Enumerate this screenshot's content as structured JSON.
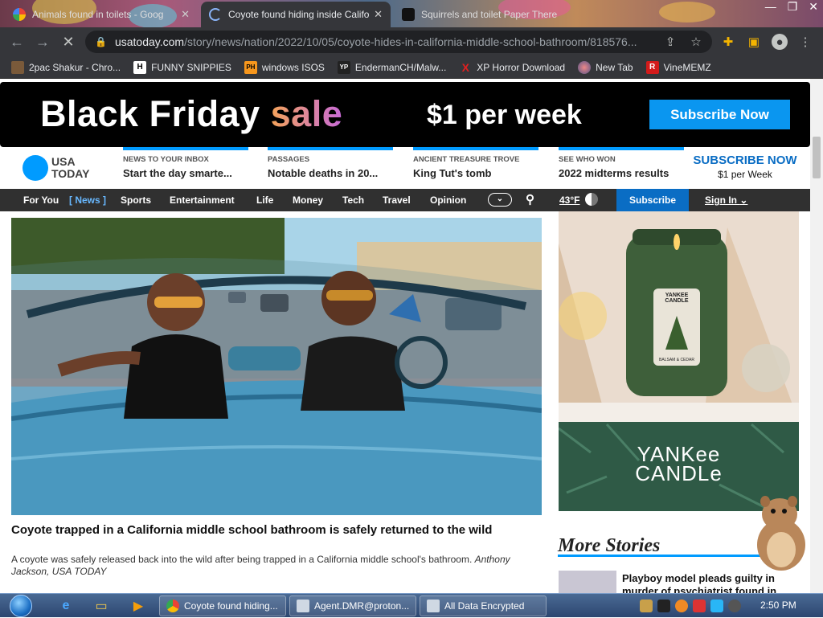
{
  "browser": {
    "tabs": [
      {
        "title": "Animals found in toilets - Goog",
        "active": false
      },
      {
        "title": "Coyote found hiding inside Califo",
        "active": true
      },
      {
        "title": "Squirrels and toilet Paper There",
        "active": false
      }
    ],
    "url_host": "usatoday.com",
    "url_path": "/story/news/nation/2022/10/05/coyote-hides-in-california-middle-school-bathroom/818576...",
    "bookmarks": [
      {
        "label": "2pac Shakur - Chro...",
        "icon": "icon-2pac"
      },
      {
        "label": "FUNNY SNIPPIES",
        "icon": "H"
      },
      {
        "label": "windows ISOS",
        "icon": "PH"
      },
      {
        "label": "EndermanCH/Malw...",
        "icon": "YP"
      },
      {
        "label": "XP Horror Download",
        "icon": "X"
      },
      {
        "label": "New Tab",
        "icon": "globe"
      },
      {
        "label": "VineMEMZ",
        "icon": "R"
      }
    ]
  },
  "ad_top": {
    "black_friday": "Black Friday",
    "sale": "sale",
    "price": "$1 per week",
    "cta": "Subscribe Now"
  },
  "masthead": {
    "logo_line1": "USA",
    "logo_line2": "TODAY",
    "promos": [
      {
        "kicker": "NEWS TO YOUR INBOX",
        "title": "Start the day smarte..."
      },
      {
        "kicker": "PASSAGES",
        "title": "Notable deaths in 20..."
      },
      {
        "kicker": "ANCIENT TREASURE TROVE",
        "title": "King Tut's tomb"
      },
      {
        "kicker": "SEE WHO WON",
        "title": "2022 midterms results"
      }
    ],
    "subscribe_now": "SUBSCRIBE NOW",
    "subscribe_price": "$1 per Week"
  },
  "nav": {
    "items": [
      "For You",
      "[ News ]",
      "Sports",
      "Entertainment",
      "Life",
      "Money",
      "Tech",
      "Travel",
      "Opinion"
    ],
    "weather": "43°F",
    "subscribe": "Subscribe",
    "sign_in": "Sign In"
  },
  "article": {
    "headline": "Coyote trapped in a California middle school bathroom is safely returned to the wild",
    "summary": "A coyote was safely released back into the wild after being trapped in a California middle school's bathroom.",
    "byline": "Anthony Jackson, USA TODAY"
  },
  "ad_right": {
    "jar_label_brand": "YANKEE CANDLE",
    "jar_label_scent": "BALSAM & CEDAR",
    "brand_line1": "YANKee",
    "brand_line2": "CANDLe"
  },
  "more_stories": {
    "heading": "More Stories",
    "first_title": "Playboy model pleads guilty in murder of psychiatrist found in"
  },
  "taskbar": {
    "tasks": [
      "Coyote found hiding...",
      "Agent.DMR@proton...",
      "All Data Encrypted"
    ],
    "clock": "2:50 PM"
  }
}
